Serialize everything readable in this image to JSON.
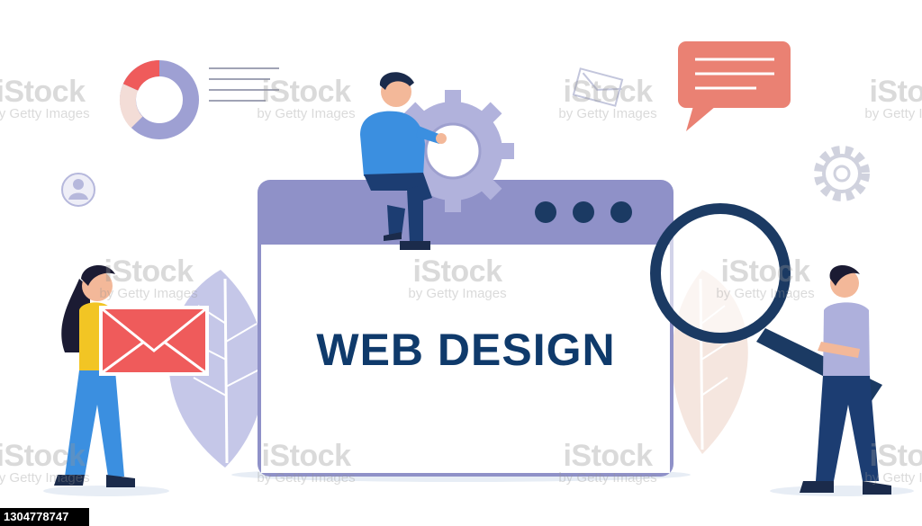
{
  "headline": "WEB DESIGN",
  "stock_id": "1304778747",
  "watermark": {
    "brand": "iStock",
    "byline": "by Getty Images"
  },
  "colors": {
    "accent_purple": "#8f91c8",
    "navy": "#103a6b",
    "email_red": "#ef5b5b",
    "speech_bubble": "#ea8173",
    "gear": "#b1b2dc",
    "browser_dots": "#1b3a63"
  },
  "icons": [
    "donut-chart-icon",
    "speech-bubble-icon",
    "gear-icon",
    "user-circle-icon",
    "envelope-icon",
    "magnifier-icon"
  ]
}
